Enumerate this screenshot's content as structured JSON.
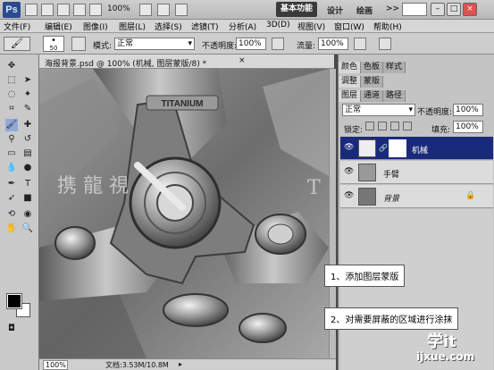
{
  "app": {
    "logo": "Ps",
    "zoom": "100%",
    "workspace_active": "基本功能",
    "workspace_links": [
      "设计",
      "绘画"
    ],
    "more": ">>"
  },
  "menu": [
    "文件(F)",
    "编辑(E)",
    "图像(I)",
    "图层(L)",
    "选择(S)",
    "滤镜(T)",
    "分析(A)",
    "3D(D)",
    "视图(V)",
    "窗口(W)",
    "帮助(H)"
  ],
  "options": {
    "brush_size": "50",
    "mode_label": "模式:",
    "mode_value": "正常",
    "opacity_label": "不透明度:",
    "opacity_value": "100%",
    "flow_label": "流量:",
    "flow_value": "100%"
  },
  "document": {
    "tab_title": "海报背景.psd @ 100% (机械, 图层蒙版/8) *",
    "close": "×",
    "brand_text": "TITANIUM",
    "status_zoom": "100%",
    "status_doc": "文档:3.53M/10.8M"
  },
  "panels": {
    "top_tabs": [
      "颜色",
      "色板",
      "样式"
    ],
    "mid_tabs": [
      "调整",
      "蒙版"
    ],
    "layer_tabs": [
      "图层",
      "通道",
      "路径"
    ],
    "blend_mode": "正常",
    "opacity_label": "不透明度:",
    "opacity_value": "100%",
    "lock_label": "锁定:",
    "fill_label": "填充:",
    "fill_value": "100%",
    "layers": [
      {
        "name": "机械",
        "selected": true
      },
      {
        "name": "手臂",
        "selected": false
      },
      {
        "name": "背景",
        "selected": false
      }
    ]
  },
  "callouts": {
    "step1": "1、添加图层蒙版",
    "step2": "2、对需要屏蔽的区域进行涂抹"
  },
  "watermark": {
    "left": "携 龍 視",
    "right": "T",
    "corner_top": "学it",
    "corner_bottom": "ijxue.com"
  }
}
